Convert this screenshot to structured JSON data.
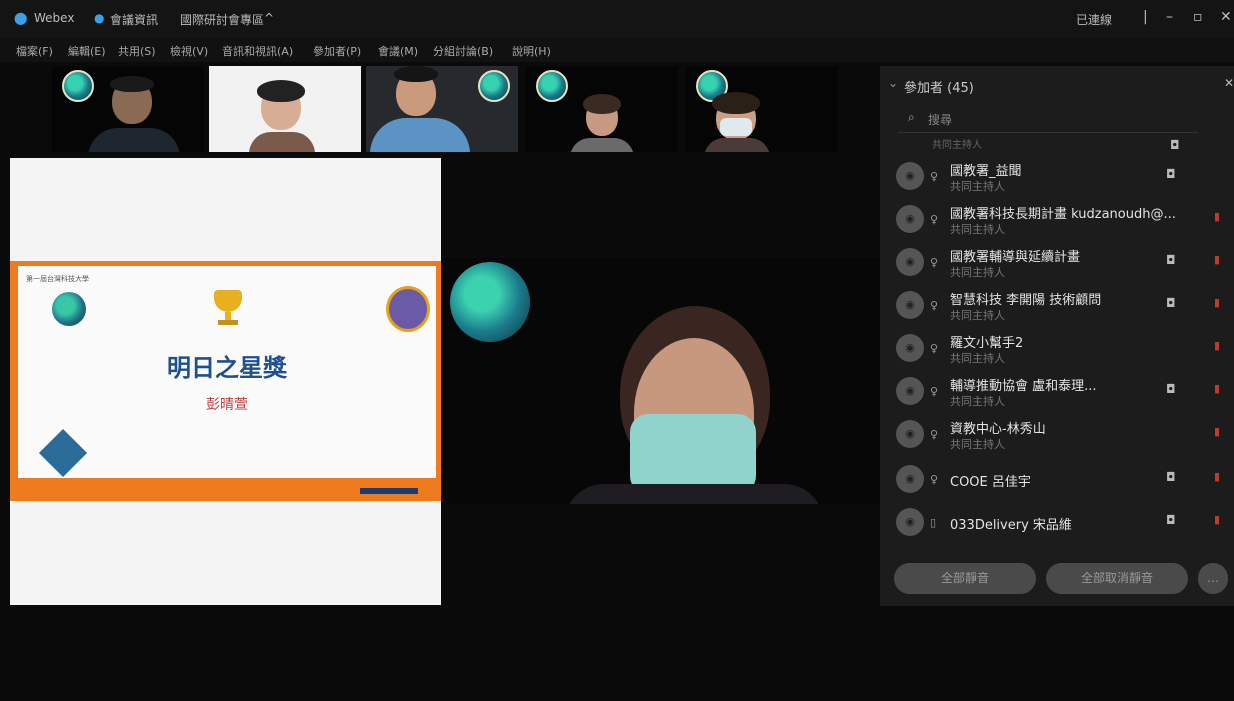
{
  "titlebar": {
    "app_name": "Webex",
    "tab_1": "會議資訊",
    "tab_2": "國際研討會專區",
    "status": "已連線"
  },
  "menu": [
    "檔案(F)",
    "編輯(E)",
    "共用(S)",
    "檢視(V)",
    "音訊和視訊(A)",
    "參加者(P)",
    "會議(M)",
    "分組討論(B)",
    "說明(H)"
  ],
  "slide": {
    "corner_text": "第一屆台灣科技大學",
    "title": "明日之星獎",
    "awardee": "彭晴萱"
  },
  "panel": {
    "title": "參加者 (45)",
    "search_placeholder": "搜尋",
    "role_label": "共同主持人",
    "participants": [
      {
        "name": "國教署_益聞",
        "role": "共同主持人"
      },
      {
        "name": "國教署科技長期計畫 kudzanoudh@...",
        "role": "共同主持人"
      },
      {
        "name": "國教署輔導與延續計畫",
        "role": "共同主持人"
      },
      {
        "name": "智慧科技 李開陽 技術顧問",
        "role": "共同主持人"
      },
      {
        "name": "羅文小幫手2",
        "role": "共同主持人"
      },
      {
        "name": "輔導推動協會 盧和泰理...",
        "role": "共同主持人"
      },
      {
        "name": "資教中心-林秀山",
        "role": "共同主持人"
      },
      {
        "name": "COOE 呂佳宇",
        "role": ""
      },
      {
        "name": "033Delivery 宋品維",
        "role": ""
      }
    ],
    "mute_all": "全部靜音",
    "unmute_all": "全部取消靜音"
  },
  "colors": {
    "accent_orange": "#f07a1e",
    "title_blue": "#1e4f8f",
    "flag_red": "#c0392b"
  }
}
